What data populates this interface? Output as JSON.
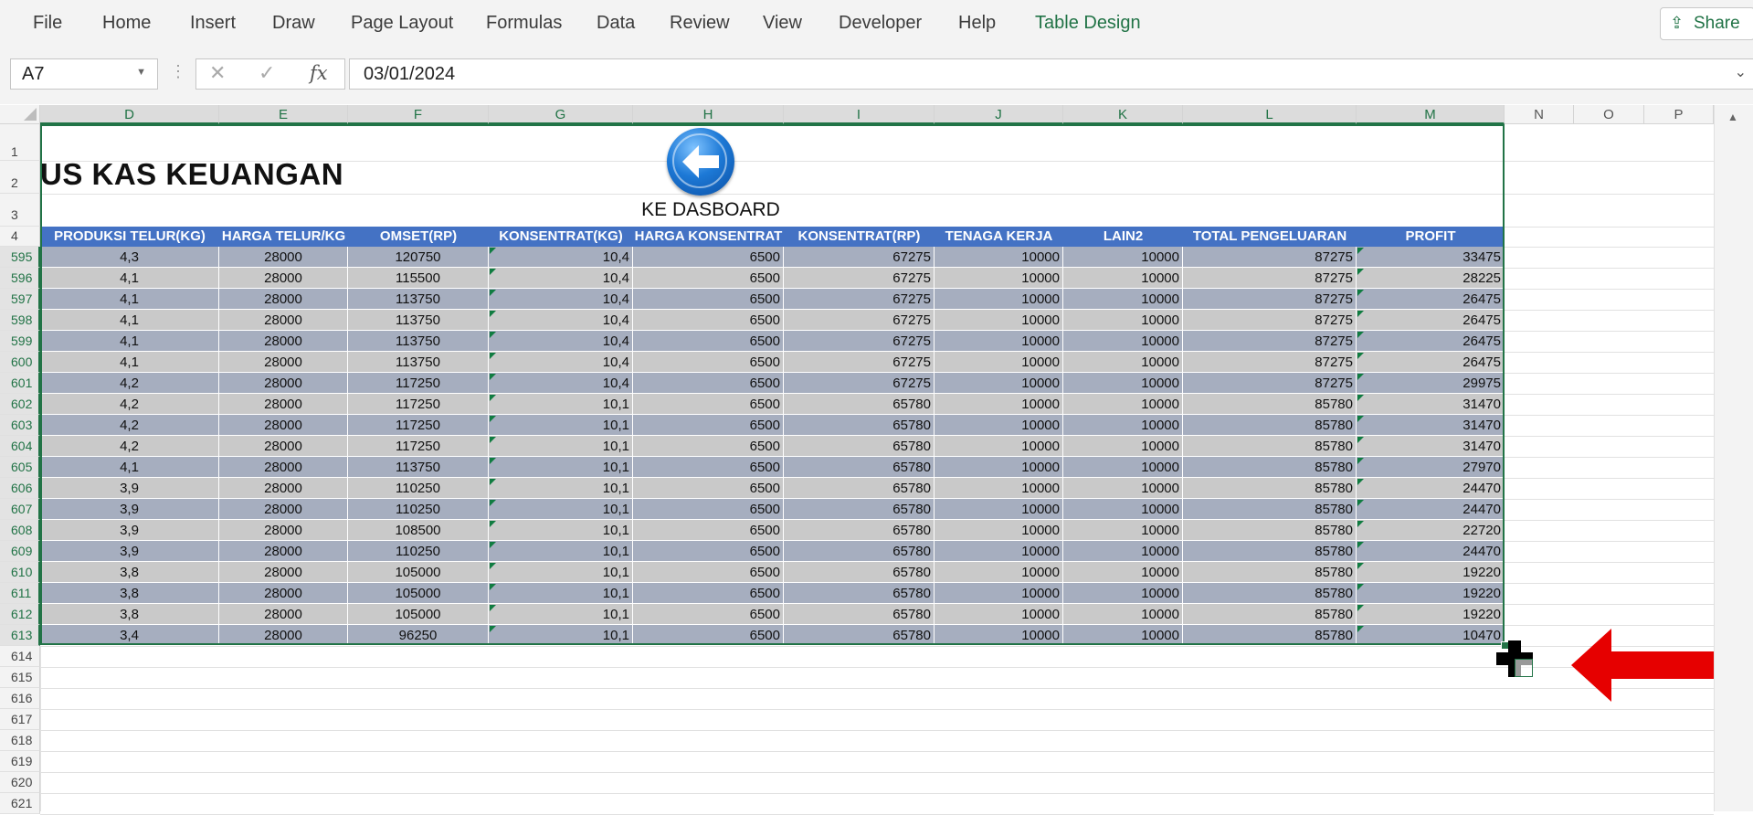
{
  "ribbon": {
    "tabs": [
      "File",
      "Home",
      "Insert",
      "Draw",
      "Page Layout",
      "Formulas",
      "Data",
      "Review",
      "View",
      "Developer",
      "Help",
      "Table Design"
    ],
    "share_label": "Share"
  },
  "formula_bar": {
    "name_box": "A7",
    "formula": "03/01/2024",
    "fx": "fx"
  },
  "columns": [
    "D",
    "E",
    "F",
    "G",
    "H",
    "I",
    "J",
    "K",
    "L",
    "M",
    "N",
    "O",
    "P"
  ],
  "top_rows": [
    "1",
    "2",
    "3",
    "4"
  ],
  "sheet": {
    "title": "US KAS KEUANGAN",
    "button_label": "KE DASBOARD"
  },
  "table": {
    "headers": [
      "PRODUKSI TELUR(KG)",
      "HARGA TELUR/KG",
      "OMSET(RP)",
      "KONSENTRAT(KG)",
      "HARGA KONSENTRAT",
      "KONSENTRAT(RP)",
      "TENAGA KERJA",
      "LAIN2",
      "TOTAL PENGELUARAN",
      "PROFIT"
    ],
    "rows": [
      {
        "n": "595",
        "v": [
          "4,3",
          "28000",
          "120750",
          "10,4",
          "6500",
          "67275",
          "10000",
          "10000",
          "87275",
          "33475"
        ]
      },
      {
        "n": "596",
        "v": [
          "4,1",
          "28000",
          "115500",
          "10,4",
          "6500",
          "67275",
          "10000",
          "10000",
          "87275",
          "28225"
        ]
      },
      {
        "n": "597",
        "v": [
          "4,1",
          "28000",
          "113750",
          "10,4",
          "6500",
          "67275",
          "10000",
          "10000",
          "87275",
          "26475"
        ]
      },
      {
        "n": "598",
        "v": [
          "4,1",
          "28000",
          "113750",
          "10,4",
          "6500",
          "67275",
          "10000",
          "10000",
          "87275",
          "26475"
        ]
      },
      {
        "n": "599",
        "v": [
          "4,1",
          "28000",
          "113750",
          "10,4",
          "6500",
          "67275",
          "10000",
          "10000",
          "87275",
          "26475"
        ]
      },
      {
        "n": "600",
        "v": [
          "4,1",
          "28000",
          "113750",
          "10,4",
          "6500",
          "67275",
          "10000",
          "10000",
          "87275",
          "26475"
        ]
      },
      {
        "n": "601",
        "v": [
          "4,2",
          "28000",
          "117250",
          "10,4",
          "6500",
          "67275",
          "10000",
          "10000",
          "87275",
          "29975"
        ]
      },
      {
        "n": "602",
        "v": [
          "4,2",
          "28000",
          "117250",
          "10,1",
          "6500",
          "65780",
          "10000",
          "10000",
          "85780",
          "31470"
        ]
      },
      {
        "n": "603",
        "v": [
          "4,2",
          "28000",
          "117250",
          "10,1",
          "6500",
          "65780",
          "10000",
          "10000",
          "85780",
          "31470"
        ]
      },
      {
        "n": "604",
        "v": [
          "4,2",
          "28000",
          "117250",
          "10,1",
          "6500",
          "65780",
          "10000",
          "10000",
          "85780",
          "31470"
        ]
      },
      {
        "n": "605",
        "v": [
          "4,1",
          "28000",
          "113750",
          "10,1",
          "6500",
          "65780",
          "10000",
          "10000",
          "85780",
          "27970"
        ]
      },
      {
        "n": "606",
        "v": [
          "3,9",
          "28000",
          "110250",
          "10,1",
          "6500",
          "65780",
          "10000",
          "10000",
          "85780",
          "24470"
        ]
      },
      {
        "n": "607",
        "v": [
          "3,9",
          "28000",
          "110250",
          "10,1",
          "6500",
          "65780",
          "10000",
          "10000",
          "85780",
          "24470"
        ]
      },
      {
        "n": "608",
        "v": [
          "3,9",
          "28000",
          "108500",
          "10,1",
          "6500",
          "65780",
          "10000",
          "10000",
          "85780",
          "22720"
        ]
      },
      {
        "n": "609",
        "v": [
          "3,9",
          "28000",
          "110250",
          "10,1",
          "6500",
          "65780",
          "10000",
          "10000",
          "85780",
          "24470"
        ]
      },
      {
        "n": "610",
        "v": [
          "3,8",
          "28000",
          "105000",
          "10,1",
          "6500",
          "65780",
          "10000",
          "10000",
          "85780",
          "19220"
        ]
      },
      {
        "n": "611",
        "v": [
          "3,8",
          "28000",
          "105000",
          "10,1",
          "6500",
          "65780",
          "10000",
          "10000",
          "85780",
          "19220"
        ]
      },
      {
        "n": "612",
        "v": [
          "3,8",
          "28000",
          "105000",
          "10,1",
          "6500",
          "65780",
          "10000",
          "10000",
          "85780",
          "19220"
        ]
      },
      {
        "n": "613",
        "v": [
          "3,4",
          "28000",
          "96250",
          "10,1",
          "6500",
          "65780",
          "10000",
          "10000",
          "85780",
          "10470"
        ]
      }
    ]
  },
  "empty_rows": [
    "614",
    "615",
    "616",
    "617",
    "618",
    "619",
    "620",
    "621"
  ],
  "colors": {
    "accent": "#217346",
    "table_header": "#4472c4",
    "band_dark": "#a6aebf",
    "band_light": "#c9c9c9",
    "annotation_arrow": "#e60000"
  }
}
